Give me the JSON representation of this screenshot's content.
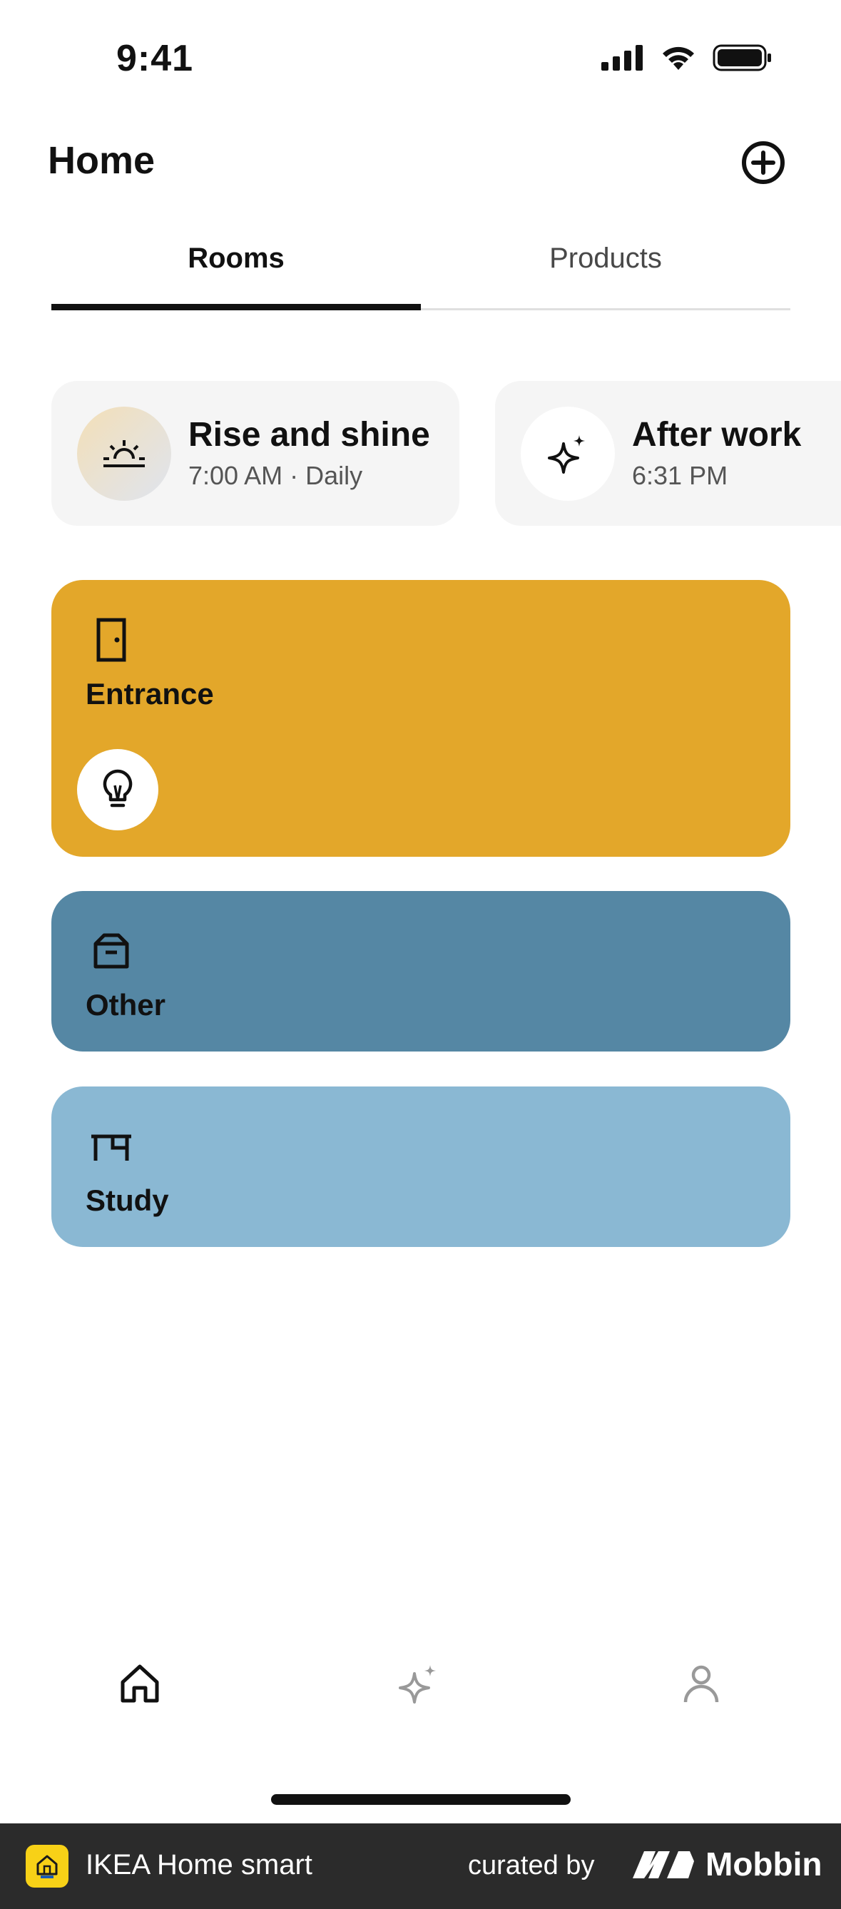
{
  "status_bar": {
    "time": "9:41",
    "icons": [
      "signal-icon",
      "wifi-icon",
      "battery-icon"
    ]
  },
  "header": {
    "title": "Home",
    "add_icon": "plus-circle-icon"
  },
  "tabs": [
    {
      "label": "Rooms",
      "active": true
    },
    {
      "label": "Products",
      "active": false
    }
  ],
  "scenes": [
    {
      "name": "Rise and shine",
      "time": "7:00 AM · Daily",
      "icon": "sunrise-icon"
    },
    {
      "name": "After work",
      "time": "6:31 PM",
      "icon": "sparkle-icon"
    }
  ],
  "rooms": [
    {
      "name": "Entrance",
      "icon": "door-icon",
      "color": "#e3a72a",
      "devices": [
        "lightbulb-icon"
      ]
    },
    {
      "name": "Other",
      "icon": "box-icon",
      "color": "#5587a4",
      "devices": []
    },
    {
      "name": "Study",
      "icon": "desk-icon",
      "color": "#8ab8d3",
      "devices": []
    }
  ],
  "bottom_nav": [
    {
      "icon": "home-icon",
      "active": true
    },
    {
      "icon": "sparkle-icon",
      "active": false
    },
    {
      "icon": "profile-icon",
      "active": false
    }
  ],
  "footer": {
    "app_name": "IKEA Home smart",
    "curated_by": "curated by",
    "brand": "Mobbin"
  },
  "colors": {
    "footer_bg": "#2b2b2b",
    "logo_yellow": "#f7d117",
    "active_tab": "#111111"
  }
}
